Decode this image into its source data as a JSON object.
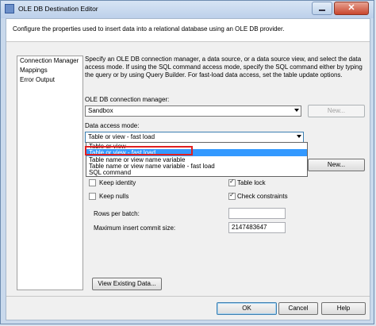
{
  "window": {
    "title": "OLE DB Destination Editor",
    "close_glyph": "✕"
  },
  "header": {
    "text": "Configure the properties used to insert data into a relational database using an OLE DB provider."
  },
  "nav": {
    "items": [
      "Connection Manager",
      "Mappings",
      "Error Output"
    ]
  },
  "main": {
    "description": "Specify an OLE DB connection manager, a data source, or a data source view, and select the data access mode. If using the SQL command access mode, specify the SQL command either by typing the query or by using Query Builder. For fast-load data access, set the table update options.",
    "connection_manager_label": "OLE DB connection manager:",
    "connection_manager_value": "Sandbox",
    "new_connection_label": "New...",
    "data_access_mode_label": "Data access mode:",
    "data_access_mode_value": "Table or view - fast load",
    "dropdown_options": [
      "Table or view",
      "Table or view - fast load",
      "Table name or view name variable",
      "Table name or view name variable - fast load",
      "SQL command"
    ],
    "new_table_label": "New...",
    "keep_identity_label": "Keep identity",
    "keep_nulls_label": "Keep nulls",
    "table_lock_label": "Table lock",
    "check_constraints_label": "Check constraints",
    "rows_per_batch_label": "Rows per batch:",
    "rows_per_batch_value": "",
    "max_insert_commit_label": "Maximum insert commit size:",
    "max_insert_commit_value": "2147483647",
    "view_existing_data_label": "View Existing Data..."
  },
  "footer": {
    "ok_label": "OK",
    "cancel_label": "Cancel",
    "help_label": "Help"
  },
  "checkboxes": {
    "keep_identity": false,
    "keep_nulls": false,
    "table_lock": true,
    "check_constraints": true
  },
  "colors": {
    "selection": "#3399ff",
    "highlight_box": "#e02020",
    "title_bar": "#bcd0ea"
  }
}
